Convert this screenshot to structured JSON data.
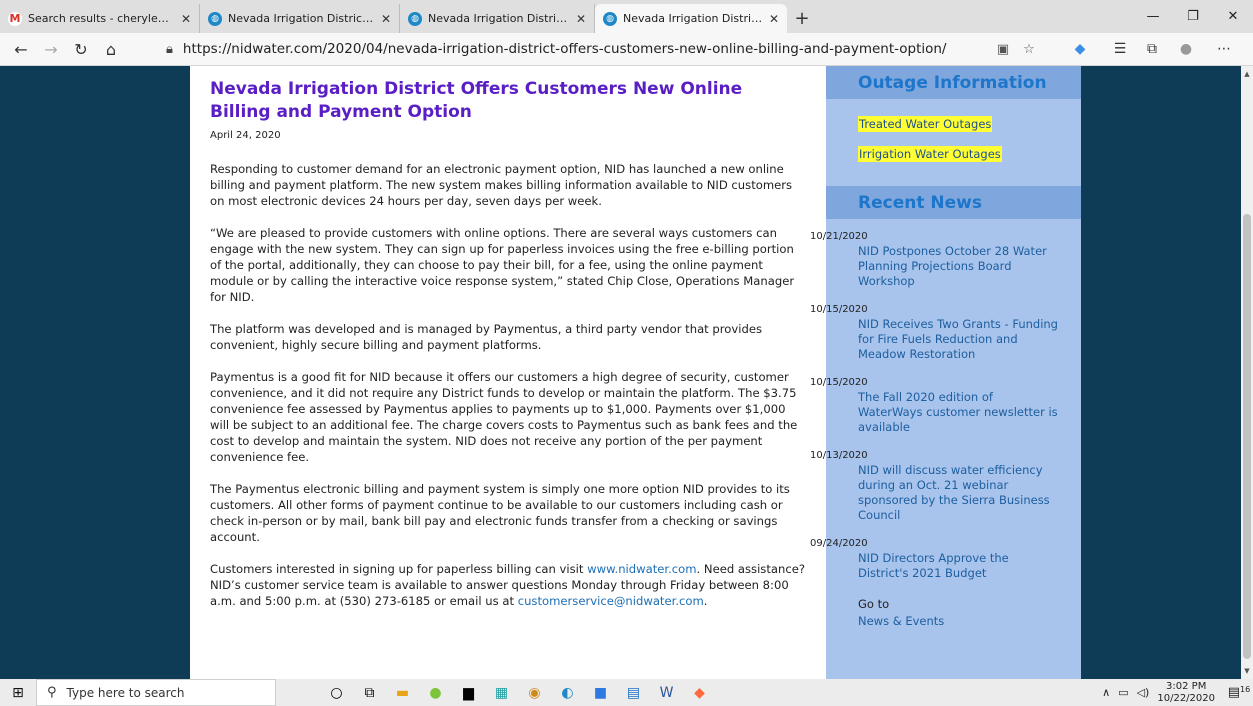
{
  "browser": {
    "tabs": [
      {
        "label": "Search results - cheryledell@gm",
        "icon": "gmail-icon"
      },
      {
        "label": "Nevada Irrigation District » Press",
        "icon": "nid-icon"
      },
      {
        "label": "Nevada Irrigation District » Abou",
        "icon": "nid-icon"
      },
      {
        "label": "Nevada Irrigation District » Neva",
        "icon": "nid-icon"
      }
    ],
    "url": "https://nidwater.com/2020/04/nevada-irrigation-district-offers-customers-new-online-billing-and-payment-option/"
  },
  "article": {
    "title": "Nevada Irrigation District Offers Customers New Online Billing and Payment Option",
    "date": "April 24, 2020",
    "p1": "Responding to customer demand for an electronic payment option, NID has launched a new online billing and payment platform. The new system makes billing information available to NID customers on most electronic devices 24 hours per day, seven days per week.",
    "p2": "“We are pleased to provide customers with online options. There are several ways customers can engage with the new system. They can sign up for paperless invoices using the free e-billing portion of the portal, additionally, they can choose to pay their bill, for a fee, using the online payment module or by calling the interactive voice response system,” stated Chip Close, Operations Manager for NID.",
    "p3": "The platform was developed and is managed by Paymentus, a third party vendor that provides convenient, highly secure billing and payment platforms.",
    "p4": "Paymentus is a good fit for NID because it offers our customers a high degree of security, customer convenience, and it did not require any District funds to develop or maintain the platform. The $3.75 convenience fee assessed by Paymentus applies to payments up to $1,000. Payments over $1,000 will be subject to an additional fee. The charge covers costs to Paymentus such as bank fees and the cost to develop and maintain the system. NID does not receive any portion of the per payment convenience fee.",
    "p5": "The Paymentus electronic billing and payment system is simply one more option NID provides to its customers. All other forms of payment continue to be available to our customers including cash or check in-person or by mail, bank bill pay and electronic funds transfer from a checking or savings account.",
    "p6a": "Customers interested in signing up for paperless billing can visit ",
    "p6link": "www.nidwater.com",
    "p6b": ". Need assistance? NID’s customer service team is available to answer questions Monday through Friday between 8:00 a.m. and 5:00 p.m. at (530) 273-6185 or email us at ",
    "p6email": "customerservice@nidwater.com",
    "p6c": "."
  },
  "sidebar": {
    "outage_heading": "Outage Information",
    "outage_links": [
      "Treated Water Outages",
      "Irrigation Water Outages"
    ],
    "news_heading": "Recent News",
    "news": [
      {
        "date": "10/21/2020",
        "title": "NID Postpones October 28 Water Planning Projections Board Workshop"
      },
      {
        "date": "10/15/2020",
        "title": "NID Receives Two Grants - Funding for Fire Fuels Reduction and Meadow Restoration"
      },
      {
        "date": "10/15/2020",
        "title": "The Fall 2020 edition of WaterWays customer newsletter is available"
      },
      {
        "date": "10/13/2020",
        "title": "NID will discuss water efficiency during an Oct. 21 webinar sponsored by the Sierra Business Council"
      },
      {
        "date": "09/24/2020",
        "title": "NID Directors Approve the District's 2021 Budget"
      }
    ],
    "goto_label": "Go to",
    "goto_link": "News & Events"
  },
  "taskbar": {
    "search_placeholder": "Type here to search",
    "time": "3:02 PM",
    "date": "10/22/2020",
    "notifications": "16"
  }
}
